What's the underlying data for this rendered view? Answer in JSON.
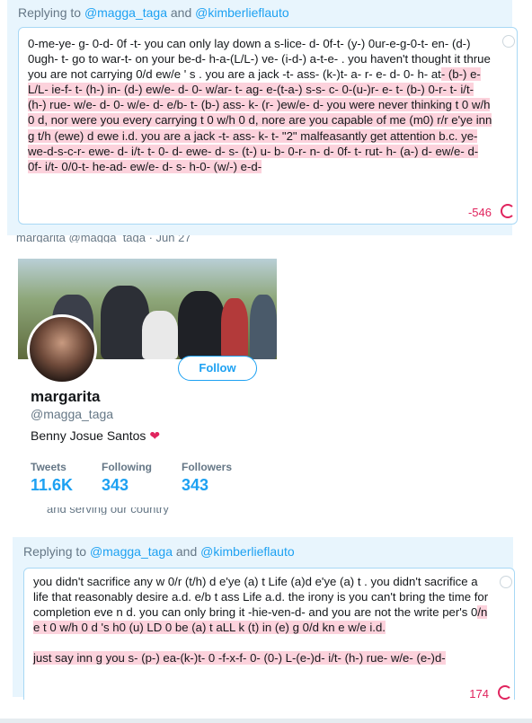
{
  "reply1": {
    "prefix": "Replying to ",
    "user1": "@magga_taga",
    "joiner": " and ",
    "user2": "@kimberlieflauto",
    "text_normal": "0-me-ye- g- 0-d- 0f -t- you can only lay down a s-lice- d- 0f-t- (y-) 0ur-e-g-0-t- en- (d-) 0ugh- t- go to war-t- on your be-d- h-a-(L/L-) ve- (i-d-) a-t-e- . you haven't thought it thrue you are not carrying 0/d ew/e ' s . you are a jack -t- ass- (k-)t- a- r- e- d- 0- h- at",
    "text_over": "- (b-) e- L/L- ie-f- t- (h-) in- (d-) ew/e- d- 0- w/ar- t- ag- e-(t-a-) s-s- c- 0-(u-)r- e- t- (b-) 0-r- t- i/t- (h-) rue- w/e- d- 0- w/e- d- e/b- t- (b-) ass- k- (r- )ew/e- d- you were never thinking t 0 w/h 0 d, nor were you every carrying t 0 w/h 0 d, nore are you capable of me (m0) r/r e'ye inn g t/h (ewe) d ewe i.d. you are a jack -t- ass- k- t- \"2\" malfeasantly get attention b.c. ye-we-d-s-c-r- ewe- d- i/t- t- 0- d- ewe- d- s- (t-) u- b- 0-r- n- d- 0f- t- rut- h- (a-) d- ew/e- d- 0f- i/t- 0/0-t- he-ad- ew/e- d- s- h-0- (w/-) e-d-",
    "count": "-546"
  },
  "profile": {
    "strip_text": "margarita @magga_taga · Jun 27",
    "name": "margarita",
    "handle": "@magga_taga",
    "bio": "Benny Josue Santos",
    "bio_emoji": "❤",
    "follow_label": "Follow",
    "stats": [
      {
        "label": "Tweets",
        "value": "11.6K"
      },
      {
        "label": "Following",
        "value": "343"
      },
      {
        "label": "Followers",
        "value": "343"
      }
    ],
    "below_text": "and serving our country"
  },
  "reply2": {
    "prefix": "Replying to ",
    "user1": "@magga_taga",
    "joiner": " and ",
    "user2": "@kimberlieflauto",
    "text_normal": "you didn't sacrifice any w 0/r (t/h) d e'ye (a) t Life (a)d e'ye (a) t . you didn't sacrifice a life that reasonably desire a.d. e/b t ass Life a.d. the irony is you can't bring the time for completion eve n d. you can only bring it -hie-ven-d- and you are not the write per's 0",
    "text_over": "/n e t 0 w/h 0 d 's h0 (u) LD 0 be (a) t aLL k (t) in (e) g 0/d kn e w/e i.d.",
    "text_over2": "just say inn g you s- (p-) ea-(k-)t- 0 -f-x-f- 0- (0-) L-(e-)d- i/t- (h-) rue- w/e- (e-)d-",
    "count": "174"
  },
  "colors": {
    "accent": "#1da1f2",
    "over_limit_bg": "#fcd2dc",
    "error": "#e0245e",
    "panel_bg": "#e8f5fd"
  }
}
